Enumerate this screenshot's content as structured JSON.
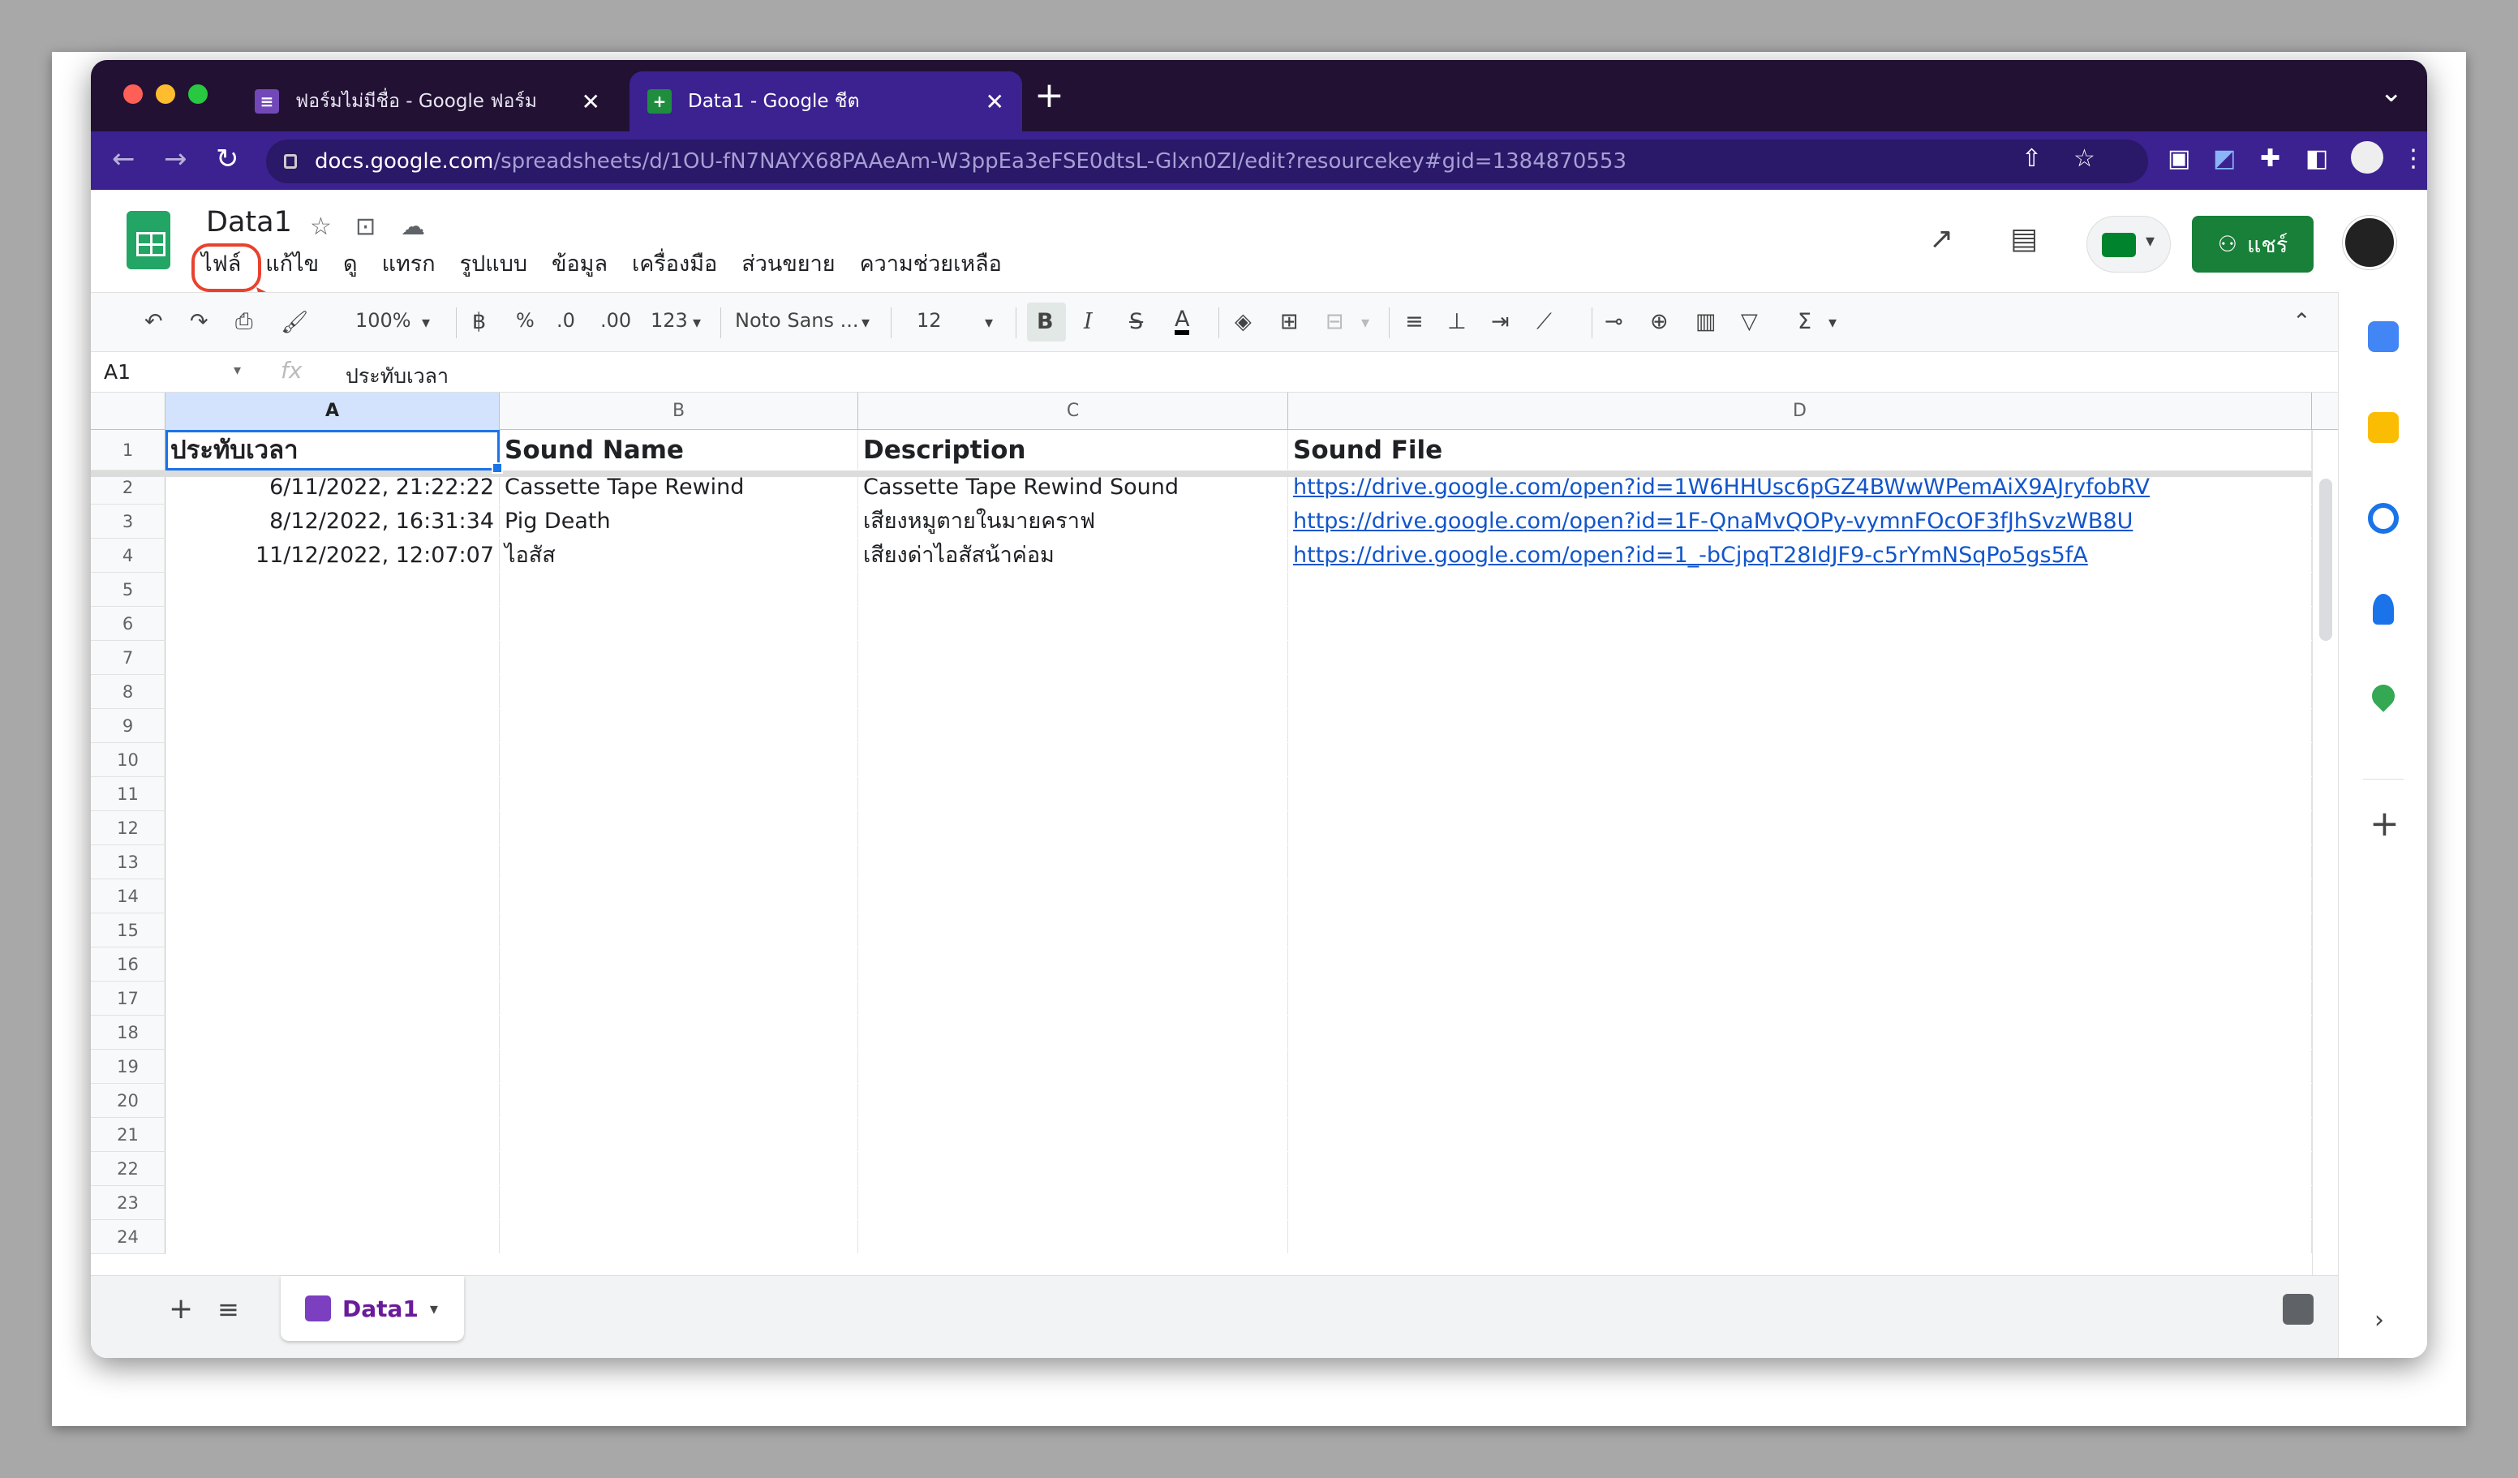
{
  "browser": {
    "tabs": [
      {
        "title": "ฟอร์มไม่มีชื่อ - Google ฟอร์ม",
        "active": false,
        "icon": "forms-icon"
      },
      {
        "title": "Data1 - Google ชีต",
        "active": true,
        "icon": "sheets-icon"
      }
    ],
    "url_host": "docs.google.com",
    "url_path": "/spreadsheets/d/1OU-fN7NAYX68PAAeAm-W3ppEa3eFSE0dtsL-Glxn0ZI/edit?resourcekey#gid=1384870553"
  },
  "sheet": {
    "title": "Data1",
    "menu": [
      "ไฟล์",
      "แก้ไข",
      "ดู",
      "แทรก",
      "รูปแบบ",
      "ข้อมูล",
      "เครื่องมือ",
      "ส่วนขยาย",
      "ความช่วยเหลือ"
    ],
    "share_label": "แชร์"
  },
  "toolbar": {
    "zoom": "100%",
    "currency": "฿",
    "percent": "%",
    "dec_decrease": ".0",
    "dec_increase": ".00",
    "more_formats": "123",
    "font": "Noto Sans ...",
    "font_size": "12",
    "bold": "B",
    "italic": "I",
    "strike": "S",
    "text_color": "A"
  },
  "formula_bar": {
    "cell_ref": "A1",
    "fx": "fx",
    "value": "ประทับเวลา"
  },
  "columns": [
    "A",
    "B",
    "C",
    "D"
  ],
  "row_numbers": [
    "1",
    "2",
    "3",
    "4",
    "5",
    "6",
    "7",
    "8",
    "9",
    "10",
    "11",
    "12",
    "13",
    "14",
    "15",
    "16",
    "17",
    "18",
    "19",
    "20",
    "21",
    "22",
    "23",
    "24"
  ],
  "header_row": [
    "ประทับเวลา",
    "Sound Name",
    "Description",
    "Sound File"
  ],
  "rows": [
    [
      "6/11/2022, 21:22:22",
      "Cassette Tape Rewind",
      "Cassette Tape Rewind Sound",
      "https://drive.google.com/open?id=1W6HHUsc6pGZ4BWwWPemAiX9AJryfobRV"
    ],
    [
      "8/12/2022, 16:31:34",
      "Pig Death",
      "เสียงหมูตายในมายคราฟ",
      "https://drive.google.com/open?id=1F-QnaMvQOPy-vymnFOcOF3fJhSvzWB8U"
    ],
    [
      "11/12/2022, 12:07:07",
      "ไอสัส",
      "เสียงด่าไอสัสน้าค่อม",
      "https://drive.google.com/open?id=1_-bCjpqT28IdJF9-c5rYmNSqPo5gs5fA"
    ]
  ],
  "sheet_tab": "Data1",
  "colors": {
    "accent": "#3b2290",
    "sheets_green": "#188038",
    "annotation_red": "#e8422e",
    "link": "#1155cc"
  }
}
